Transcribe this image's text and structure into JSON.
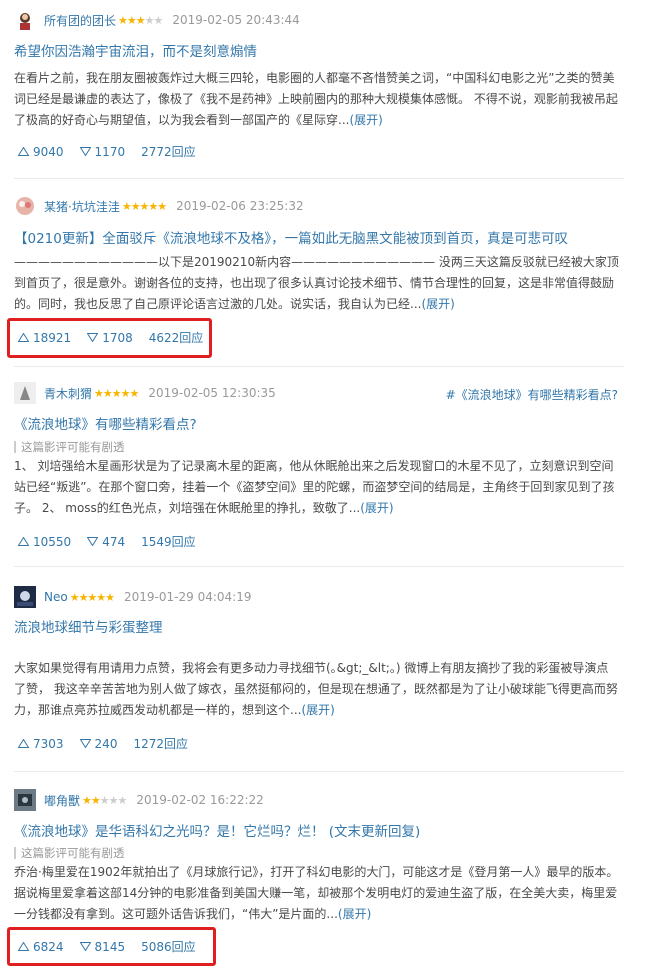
{
  "reviews": [
    {
      "author": "所有团的团长",
      "rating": 3,
      "time": "2019-02-05 20:43:44",
      "title": "希望你因浩瀚宇宙流泪，而不是刻意煽情",
      "body": "在看片之前，我在朋友圈被轰炸过大概三四轮，电影圈的人都毫不吝惜赞美之词，“中国科幻电影之光”之类的赞美词已经是最谦虚的表达了，像极了《我不是药神》上映前圈内的那种大规模集体感慨。 不得不说，观影前我被吊起了极高的好奇心与期望值，以为我会看到一部国产的《星际穿...",
      "more": "(展开)",
      "up": "9040",
      "down": "1170",
      "replies": "2772回应"
    },
    {
      "author": "某猪·坑坑洼洼",
      "rating": 5,
      "time": "2019-02-06 23:25:32",
      "title": "【0210更新】全面驳斥《流浪地球不及格》，一篇如此无脑黑文能被顶到首页，真是可悲可叹",
      "body": "————————————以下是20190210新内容———————————— 没两三天这篇反驳就已经被大家顶到首页了，很是意外。谢谢各位的支持，也出现了很多认真讨论技术细节、情节合理性的回复，这是非常值得鼓励的。同时，我也反思了自己原评论语言过激的几处。说实话，我自认为已经...",
      "more": "(展开)",
      "up": "18921",
      "down": "1708",
      "replies": "4622回应"
    },
    {
      "author": "青木刺猬",
      "rating": 5,
      "time": "2019-02-05 12:30:35",
      "topic": "#《流浪地球》有哪些精彩看点?",
      "title": "《流浪地球》有哪些精彩看点?",
      "warning": "这篇影评可能有剧透",
      "body": "1、 刘培强给木星画形状是为了记录离木星的距离，他从休眠舱出来之后发现窗口的木星不见了，立刻意识到空间站已经“叛逃”。在那个窗口旁，挂着一个《盗梦空间》里的陀螺，而盗梦空间的结局是，主角终于回到家见到了孩子。 2、 moss的红色光点，刘培强在休眠舱里的挣扎，致敬了...",
      "more": "(展开)",
      "up": "10550",
      "down": "474",
      "replies": "1549回应"
    },
    {
      "author": "Neo",
      "rating": 5,
      "time": "2019-01-29 04:04:19",
      "title": "流浪地球细节与彩蛋整理",
      "body": "大家如果觉得有用请用力点赞，我将会有更多动力寻找细节(｡&gt;_&lt;｡)  微博上有朋友摘抄了我的彩蛋被导演点了赞，  我这辛辛苦苦地为别人做了嫁衣，虽然挺郁闷的，但是现在想通了，既然都是为了让小破球能飞得更高而努力，那谁点亮苏拉威西发动机都是一样的，想到这个...",
      "more": "(展开)",
      "up": "7303",
      "down": "240",
      "replies": "1272回应"
    },
    {
      "author": "嘟角獸",
      "rating": 2,
      "time": "2019-02-02 16:22:22",
      "title": "《流浪地球》是华语科幻之光吗？是！它烂吗？烂！  (文末更新回复)",
      "warning": "这篇影评可能有剧透",
      "body": "乔治·梅里爱在1902年就拍出了《月球旅行记》，打开了科幻电影的大门，可能这才是《登月第一人》最早的版本。据说梅里爱拿着这部14分钟的电影准备到美国大赚一笔，却被那个发明电灯的爱迪生盗了版，在全美大卖，梅里爱一分钱都没有拿到。这可题外话告诉我们，“伟大”是片面的...",
      "more": "(展开)",
      "up": "6824",
      "down": "8145",
      "replies": "5086回应"
    }
  ],
  "colors": {
    "link": "#3377aa",
    "star": "#f7b500",
    "highlight": "#e02020"
  }
}
